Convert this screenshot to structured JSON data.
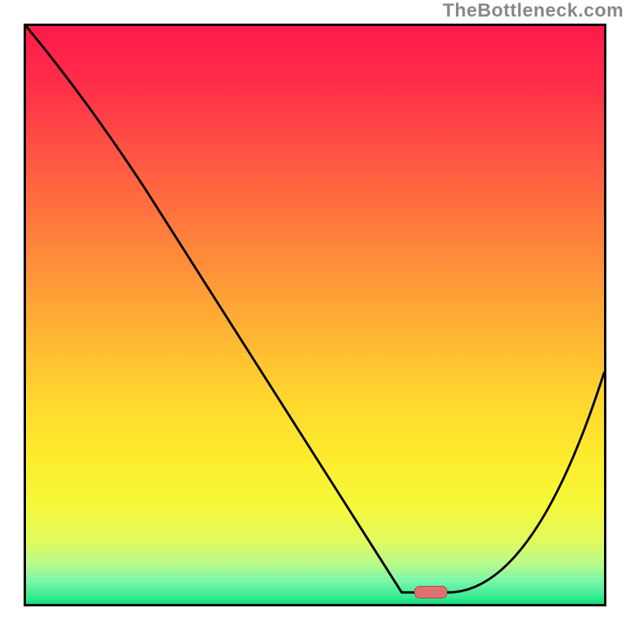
{
  "watermark": "TheBottleneck.com",
  "chart_data": {
    "type": "line",
    "title": "",
    "xlabel": "",
    "ylabel": "",
    "xlim": [
      0,
      100
    ],
    "ylim": [
      0,
      100
    ],
    "series": [
      {
        "name": "curve",
        "x": [
          0.0,
          20.5,
          65.0,
          73.0,
          100.0
        ],
        "y": [
          100.0,
          72.0,
          2.0,
          2.0,
          40.0
        ],
        "stroke": "#000000"
      }
    ],
    "marker": {
      "x": 70.0,
      "y": 2.0,
      "shape": "pill",
      "color": "#e07070"
    },
    "background": "red-yellow-green vertical gradient",
    "grid": false,
    "legend": false
  }
}
